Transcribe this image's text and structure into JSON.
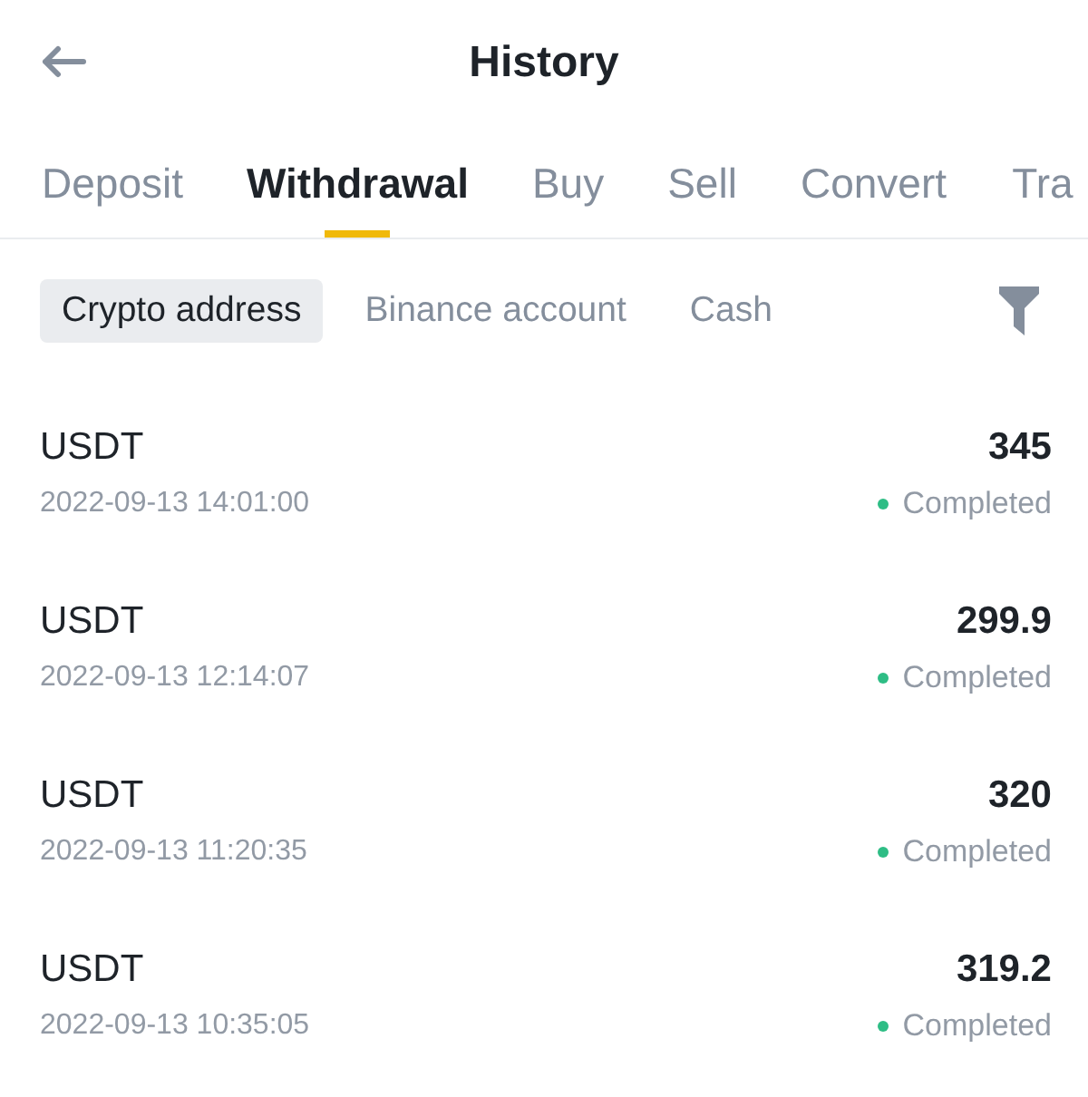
{
  "header": {
    "title": "History"
  },
  "tabs": [
    {
      "label": "Deposit",
      "selected": false
    },
    {
      "label": "Withdrawal",
      "selected": true
    },
    {
      "label": "Buy",
      "selected": false
    },
    {
      "label": "Sell",
      "selected": false
    },
    {
      "label": "Convert",
      "selected": false
    },
    {
      "label": "Tra",
      "selected": false
    }
  ],
  "filter_tabs": [
    {
      "label": "Crypto address",
      "selected": true
    },
    {
      "label": "Binance account",
      "selected": false
    },
    {
      "label": "Cash",
      "selected": false
    }
  ],
  "records": [
    {
      "asset": "USDT",
      "time": "2022-09-13 14:01:00",
      "amount": "345",
      "status": "Completed"
    },
    {
      "asset": "USDT",
      "time": "2022-09-13 12:14:07",
      "amount": "299.9",
      "status": "Completed"
    },
    {
      "asset": "USDT",
      "time": "2022-09-13 11:20:35",
      "amount": "320",
      "status": "Completed"
    },
    {
      "asset": "USDT",
      "time": "2022-09-13 10:35:05",
      "amount": "319.2",
      "status": "Completed"
    }
  ]
}
